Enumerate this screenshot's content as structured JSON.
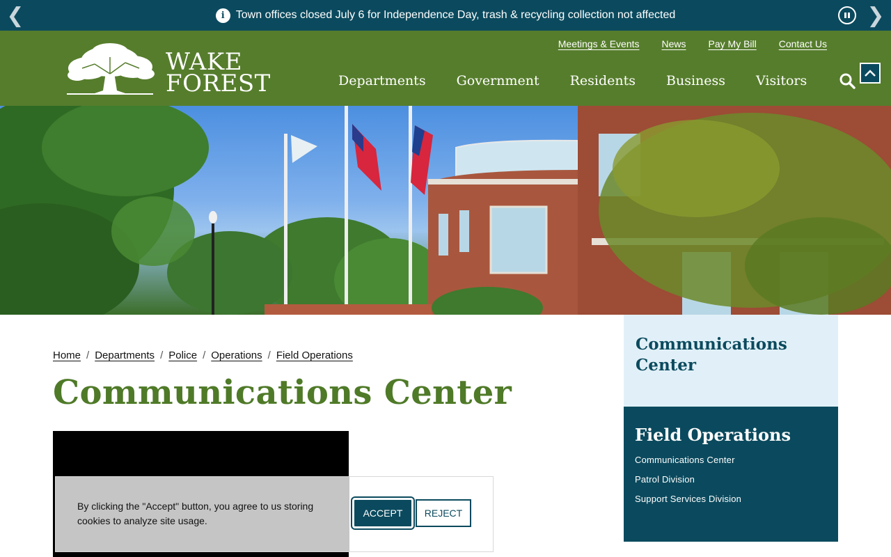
{
  "alert": {
    "message": "Town offices closed July 6 for Independence Day, trash & recycling collection not affected",
    "info_icon": "i",
    "prev_icon": "chevron-left-icon",
    "next_icon": "chevron-right-icon",
    "pause_icon": "pause-icon"
  },
  "logo": {
    "line1": "WAKE",
    "line2": "FOREST"
  },
  "utility_nav": [
    "Meetings & Events",
    "News",
    "Pay My Bill",
    "Contact Us"
  ],
  "main_nav": [
    "Departments",
    "Government",
    "Residents",
    "Business",
    "Visitors"
  ],
  "breadcrumb": [
    "Home",
    "Departments",
    "Police",
    "Operations",
    "Field Operations"
  ],
  "breadcrumb_sep": "/",
  "page_title": "Communications Center",
  "sidebar": {
    "current_title": "Communications Center",
    "section_title": "Field Operations",
    "links": [
      "Communications Center",
      "Patrol Division",
      "Support Services Division"
    ]
  },
  "cookie": {
    "text": "By clicking the \"Accept\" button, you agree to us storing cookies to analyze site usage.",
    "accept_label": "ACCEPT",
    "reject_label": "REJECT"
  },
  "colors": {
    "header_green": "#567d2c",
    "dark_teal": "#0b4a5e",
    "light_blue": "#e1f0f8",
    "title_green": "#4f7a28"
  }
}
